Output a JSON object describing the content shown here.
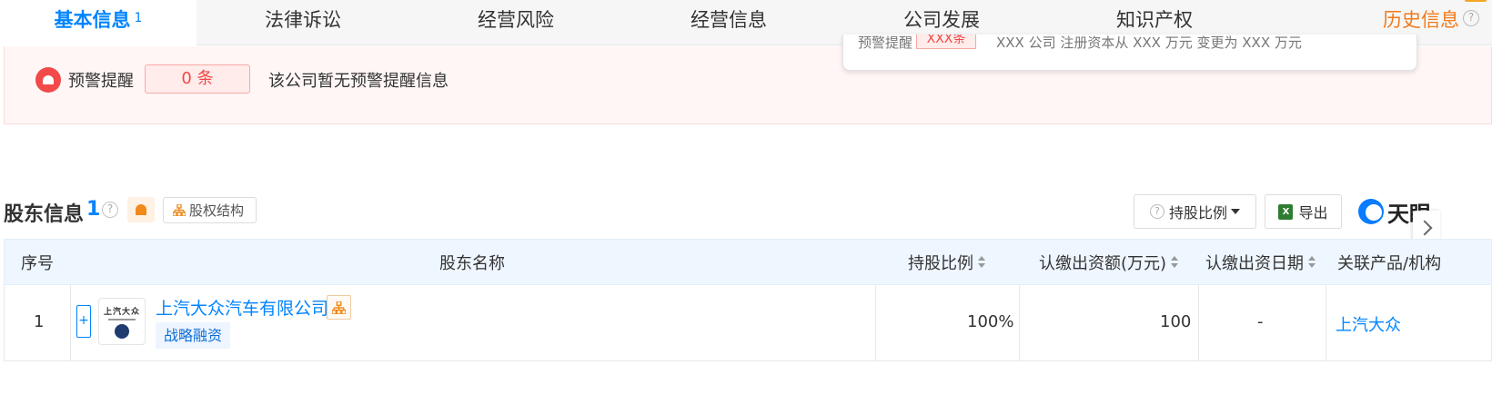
{
  "tabs": [
    {
      "label": "基本信息",
      "count": "1",
      "active": true
    },
    {
      "label": "法律诉讼"
    },
    {
      "label": "经营风险"
    },
    {
      "label": "经营信息"
    },
    {
      "label": "公司发展"
    },
    {
      "label": "知识产权"
    },
    {
      "label": "历史信息"
    }
  ],
  "warning": {
    "label": "预警提醒",
    "count": "0 条",
    "message": "该公司暂无预警提醒信息",
    "preview": {
      "label": "预警提醒",
      "tag": "XXX条",
      "text": "XXX 公司 注册资本从 XXX 万元 变更为 XXX 万元"
    }
  },
  "shareholders": {
    "title": "股东信息",
    "count": "1",
    "structure_button": "股权结构",
    "ratio_button": "持股比例",
    "export_button": "导出",
    "logo_text": "天眼",
    "columns": [
      "序号",
      "股东名称",
      "持股比例",
      "认缴出资额(万元)",
      "认缴出资日期",
      "关联产品/机构"
    ],
    "rows": [
      {
        "index": "1",
        "name": "上汽大众汽车有限公司",
        "tag": "战略融资",
        "logo_text": "上汽大众",
        "ratio": "100%",
        "amount": "100",
        "date": "-",
        "product": "上汽大众"
      }
    ]
  },
  "colors": {
    "accent": "#0084ff",
    "history": "#f07b1d",
    "danger": "#f04848"
  }
}
